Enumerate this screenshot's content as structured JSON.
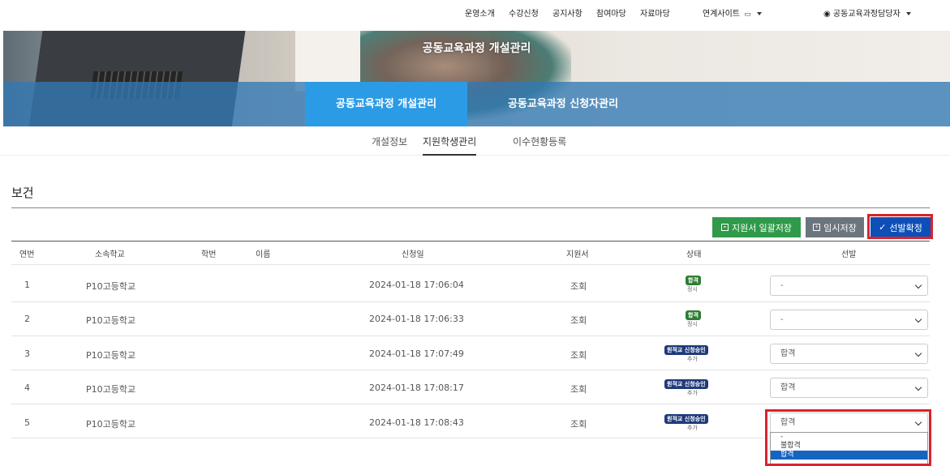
{
  "topnav": {
    "items": [
      "운영소개",
      "수강신청",
      "공지사항",
      "참여마당",
      "자료마당"
    ],
    "related_sites": "연계사이트",
    "user": "공동교육과정담당자"
  },
  "banner": {
    "title": "공동교육과정 개설관리",
    "tabs": [
      "공동교육과정 개설관리",
      "공동교육과정 신청자관리"
    ]
  },
  "subtabs": [
    "개설정보",
    "지원학생관리",
    "이수현황등록"
  ],
  "section_title": "보건",
  "actions": {
    "save_all": "지원서 일괄저장",
    "temp_save": "임시저장",
    "confirm": "선발확정"
  },
  "table": {
    "headers": [
      "연번",
      "소속학교",
      "학번",
      "이름",
      "신청일",
      "지원서",
      "상태",
      "선발"
    ],
    "rows": [
      {
        "no": "1",
        "school": "P10고등학교",
        "date": "2024-01-18 17:06:04",
        "form": "조회",
        "badge": "합격",
        "badge_sub": "정시",
        "selection": "-"
      },
      {
        "no": "2",
        "school": "P10고등학교",
        "date": "2024-01-18 17:06:33",
        "form": "조회",
        "badge": "합격",
        "badge_sub": "정시",
        "selection": "-"
      },
      {
        "no": "3",
        "school": "P10고등학교",
        "date": "2024-01-18 17:07:49",
        "form": "조회",
        "badge": "원적교 신청승인",
        "badge_sub": "추가",
        "selection": "합격"
      },
      {
        "no": "4",
        "school": "P10고등학교",
        "date": "2024-01-18 17:08:17",
        "form": "조회",
        "badge": "원적교 신청승인",
        "badge_sub": "추가",
        "selection": "합격"
      },
      {
        "no": "5",
        "school": "P10고등학교",
        "date": "2024-01-18 17:08:43",
        "form": "조회",
        "badge": "원적교 신청승인",
        "badge_sub": "추가",
        "selection": "합격"
      }
    ]
  },
  "dropdown_options": [
    "-",
    "불합격",
    "합격"
  ],
  "colors": {
    "tab_active": "#2c9be6",
    "save_green": "#2f9a49",
    "temp_gray": "#6c757d",
    "confirm_blue": "#0d4fb8",
    "highlight_red": "#d9232d",
    "badge_green": "#2e7d32",
    "badge_navy": "#1f3a7a"
  },
  "icons": {
    "user": "user-circle-icon",
    "related_sites": "window-icon",
    "save_all": "save-box-icon",
    "temp_save": "plus-box-icon",
    "confirm": "check-icon"
  }
}
